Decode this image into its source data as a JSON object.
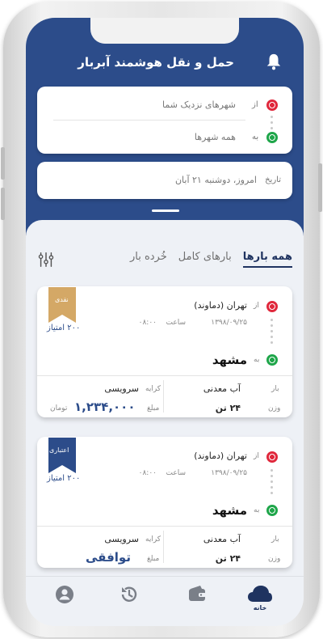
{
  "header": {
    "title": "حمل و نقل هوشمند آبربار"
  },
  "route_search": {
    "from_label": "از",
    "from_value": "شهرهای نزدیک شما",
    "to_label": "به",
    "to_value": "همه شهرها"
  },
  "date_search": {
    "label": "تاریخ",
    "value": "امروز، دوشنبه ۲۱ آبان"
  },
  "tabs": [
    {
      "label": "همه بارها",
      "active": true
    },
    {
      "label": "بارهای کامل",
      "active": false
    },
    {
      "label": "خُرده بار",
      "active": false
    }
  ],
  "cards": [
    {
      "origin_label": "از",
      "origin": "تهران (دماوند)",
      "date": "۱۳۹۸/۰۹/۲۵",
      "time_label": "ساعت",
      "time": "۰۸:۰۰",
      "dest_label": "به",
      "destination": "مشهد",
      "payment_type": "نقدی",
      "payment_color": "#d4a866",
      "points": "۲۰۰ امتیاز",
      "cargo_label": "بار",
      "cargo": "آب معدنی",
      "weight_label": "وزن",
      "weight": "۲۴ تن",
      "fare_label": "کرایه",
      "fare_type": "سرویسی",
      "amount_label": "مبلغ",
      "amount": "۱,۲۳۴,۰۰۰",
      "currency": "تومان"
    },
    {
      "origin_label": "از",
      "origin": "تهران (دماوند)",
      "date": "۱۳۹۸/۰۹/۲۵",
      "time_label": "ساعت",
      "time": "۰۸:۰۰",
      "dest_label": "به",
      "destination": "مشهد",
      "payment_type": "اعتباری",
      "payment_color": "#2c4c8a",
      "points": "۲۰۰ امتیاز",
      "cargo_label": "بار",
      "cargo": "آب معدنی",
      "weight_label": "وزن",
      "weight": "۲۴ تن",
      "fare_label": "کرایه",
      "fare_type": "سرویسی",
      "amount_label": "مبلغ",
      "amount": "توافقی",
      "currency": ""
    }
  ],
  "bottom_nav": [
    {
      "icon": "home-cloud-icon",
      "label": "خانه",
      "active": true
    },
    {
      "icon": "wallet-icon",
      "label": "",
      "active": false
    },
    {
      "icon": "history-icon",
      "label": "",
      "active": false
    },
    {
      "icon": "profile-icon",
      "label": "",
      "active": false
    }
  ],
  "colors": {
    "primary": "#2c4c8a",
    "origin": "#e0283c",
    "destination": "#1fa64a"
  }
}
